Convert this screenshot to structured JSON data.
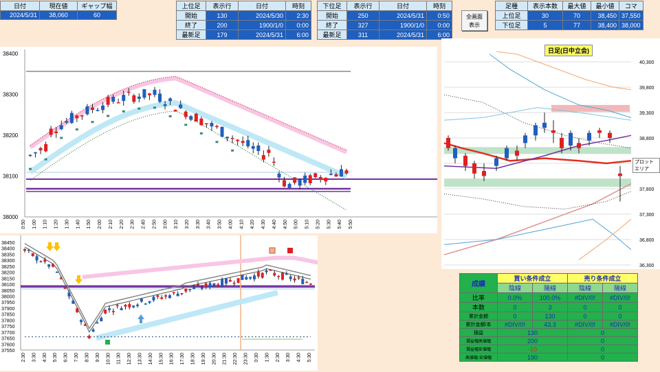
{
  "summary": {
    "headers": [
      "日付",
      "現在値",
      "ギャップ幅"
    ],
    "values": [
      "2024/5/31",
      "38,060",
      "60"
    ]
  },
  "upper_block": {
    "headers": [
      "上位足",
      "表示行",
      "日付",
      "時刻"
    ],
    "rows": [
      [
        "開始",
        "130",
        "2024/5/30",
        "2:30"
      ],
      [
        "終了",
        "200",
        "1900/1/0",
        "0:00"
      ],
      [
        "最新足",
        "179",
        "2024/5/31",
        "6:00"
      ]
    ]
  },
  "lower_block": {
    "headers": [
      "下位足",
      "表示行",
      "日付",
      "時刻"
    ],
    "rows": [
      [
        "開始",
        "250",
        "2024/5/31",
        "0:50"
      ],
      [
        "終了",
        "327",
        "1900/1/0",
        "0:00"
      ],
      [
        "最新足",
        "311",
        "2024/5/31",
        "6:00"
      ]
    ]
  },
  "fullscreen_button": {
    "line1": "全画面",
    "line2": "表示"
  },
  "bar_block": {
    "headers": [
      "足種",
      "表示本数",
      "最大値",
      "最小値",
      "コマ"
    ],
    "rows": [
      [
        "上位足",
        "30",
        "70",
        "38,450",
        "37,550"
      ],
      [
        "下位足",
        "5",
        "77",
        "38,400",
        "38,000"
      ]
    ]
  },
  "chart_upper": {
    "y_ticks": [
      "38400",
      "38300",
      "38200",
      "38100",
      "38000"
    ],
    "x_ticks": [
      "0:50",
      "1:00",
      "1:10",
      "1:20",
      "1:30",
      "1:40",
      "1:50",
      "2:00",
      "2:10",
      "2:20",
      "2:30",
      "2:40",
      "2:50",
      "3:00",
      "3:10",
      "3:20",
      "3:30",
      "3:40",
      "3:50",
      "4:00",
      "4:10",
      "4:20",
      "4:30",
      "4:40",
      "4:50",
      "5:00",
      "5:10",
      "5:20",
      "5:30",
      "5:40",
      "5:50"
    ]
  },
  "chart_lower": {
    "y_ticks": [
      "38450",
      "38400",
      "38350",
      "38300",
      "38250",
      "38200",
      "38150",
      "38100",
      "38050",
      "38000",
      "37950",
      "37900",
      "37850",
      "37800",
      "37750",
      "37700",
      "37650",
      "37600",
      "37550"
    ],
    "x_ticks": [
      "2:30",
      "3:30",
      "4:30",
      "5:30",
      "6:30",
      "7:30",
      "8:30",
      "9:30",
      "10:30",
      "11:30",
      "12:30",
      "13:30",
      "14:30",
      "15:30",
      "16:30",
      "17:30",
      "18:30",
      "19:30",
      "20:30",
      "21:30",
      "22:30",
      "23:30",
      "0:30",
      "1:30",
      "2:30",
      "3:30",
      "4:30",
      "5:30"
    ]
  },
  "chart_daily": {
    "title": "日足(日中立会)",
    "y_ticks": [
      "40,300",
      "39,800",
      "39,300",
      "38,800",
      "38,300",
      "37,800",
      "37,300",
      "36,800",
      "36,300"
    ],
    "label_plot_area": "プロットエリア"
  },
  "results": {
    "title": "成績",
    "buy_header": "買い条件成立",
    "sell_header": "売り条件成立",
    "sub": [
      "陰線",
      "陽線",
      "陰線",
      "陽線"
    ],
    "rows": [
      {
        "label": "比率",
        "vals": [
          "0.0%",
          "100.0%",
          "#DIV/0!",
          "#DIV/0!"
        ]
      },
      {
        "label": "本数",
        "vals": [
          "0",
          "3",
          "0",
          "0"
        ]
      },
      {
        "label": "累計金額",
        "vals": [
          "0",
          "130",
          "0",
          "0"
        ]
      },
      {
        "label": "累計金額/本",
        "vals": [
          "#DIV/0!",
          "43.3",
          "#DIV/0!",
          "#DIV/0!"
        ]
      }
    ],
    "totals": [
      {
        "label": "損益",
        "buy": "130",
        "sell": "0"
      },
      {
        "label": "損益幅高値幅",
        "buy": "200",
        "sell": "0"
      },
      {
        "label": "損益幅安値幅",
        "buy": "-10",
        "sell": "0"
      },
      {
        "label": "高値幅-安値幅",
        "buy": "190",
        "sell": "0"
      }
    ]
  },
  "colors": {
    "bull": "#1f5fbf",
    "bear": "#e02020",
    "background": "#fce9d6"
  }
}
